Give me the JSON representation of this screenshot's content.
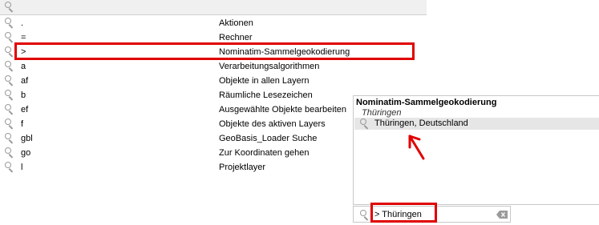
{
  "locator": {
    "rows": [
      {
        "prefix": ".",
        "description": "Aktionen"
      },
      {
        "prefix": "=",
        "description": "Rechner"
      },
      {
        "prefix": ">",
        "description": "Nominatim-Sammelgeokodierung"
      },
      {
        "prefix": "a",
        "description": "Verarbeitungsalgorithmen"
      },
      {
        "prefix": "af",
        "description": "Objekte in allen Layern"
      },
      {
        "prefix": "b",
        "description": "Räumliche Lesezeichen"
      },
      {
        "prefix": "ef",
        "description": "Ausgewählte Objekte bearbeiten"
      },
      {
        "prefix": "f",
        "description": "Objekte des aktiven Layers"
      },
      {
        "prefix": "gbl",
        "description": "GeoBasis_Loader Suche"
      },
      {
        "prefix": "go",
        "description": "Zur Koordinaten gehen"
      },
      {
        "prefix": "l",
        "description": "Projektlayer"
      }
    ]
  },
  "popup": {
    "group_title": "Nominatim-Sammelgeokodierung",
    "group_subtitle": "Thüringen",
    "result": "Thüringen, Deutschland"
  },
  "search": {
    "value": "> Thüringen"
  },
  "annotation_color": "#e00000",
  "icons": [
    "search-icon",
    "clear-icon"
  ]
}
